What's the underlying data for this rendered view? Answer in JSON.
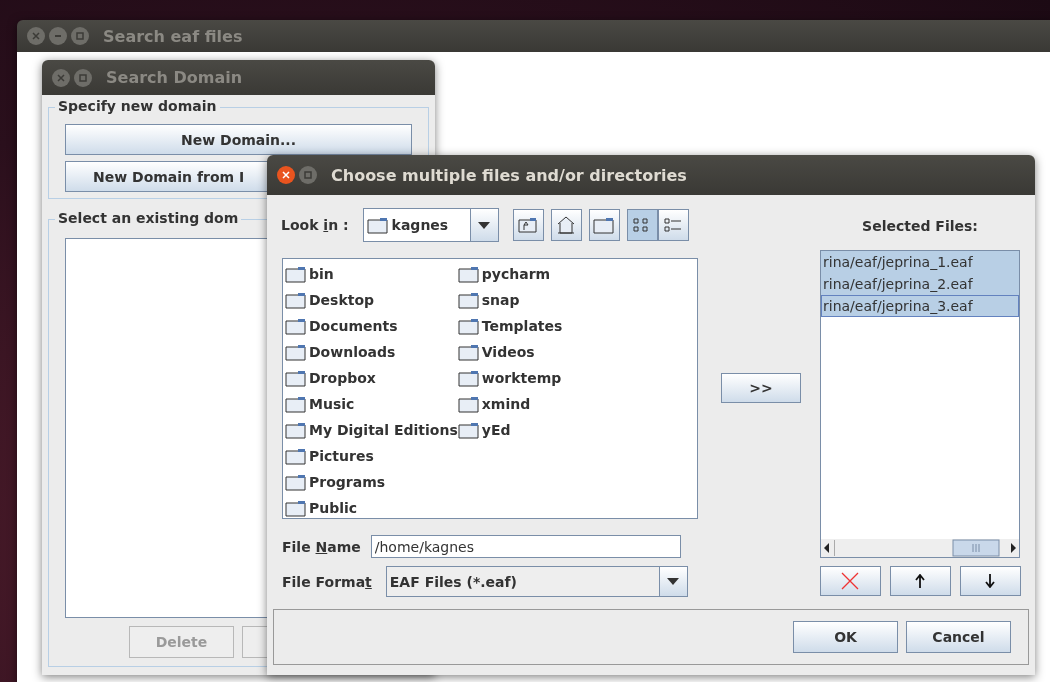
{
  "main_window": {
    "title": "Search eaf files",
    "active": false
  },
  "domain_window": {
    "title": "Search Domain",
    "active": false,
    "new_group_label": "Specify new domain",
    "new_buttons": [
      "New Domain...",
      "New Domain from I"
    ],
    "existing_group_label": "Select an existing dom",
    "delete_button": {
      "label": "Delete",
      "disabled": true
    }
  },
  "file_dialog": {
    "title": "Choose multiple files and/or directories",
    "active": true,
    "look_in": {
      "before": "Look ",
      "mnemonic": "i",
      "after": "n :",
      "value": "kagnes"
    },
    "view_modes": [
      {
        "kind": "list",
        "selected": true
      },
      {
        "kind": "details",
        "selected": false
      }
    ],
    "files": [
      "bin",
      "Desktop",
      "Documents",
      "Downloads",
      "Dropbox",
      "Music",
      "My Digital Editions",
      "Pictures",
      "Programs",
      "Public",
      "pycharm",
      "snap",
      "Templates",
      "Videos",
      "worktemp",
      "xmind",
      "yEd"
    ],
    "add_button": ">>",
    "selected_files_label": "Selected Files:",
    "selected_files": [
      {
        "name": "rina/eaf/jeprina_1.eaf",
        "selected": true
      },
      {
        "name": "rina/eaf/jeprina_2.eaf",
        "selected": true
      },
      {
        "name": "rina/eaf/jeprina_3.eaf",
        "selected": true
      }
    ],
    "file_name": {
      "before": "File ",
      "mnemonic": "N",
      "after": "ame",
      "value": "/home/kagnes"
    },
    "file_format": {
      "before": "File Forma",
      "mnemonic": "t",
      "value": "EAF Files (*.eaf)"
    },
    "ok_button": "OK",
    "cancel_button": "Cancel"
  }
}
